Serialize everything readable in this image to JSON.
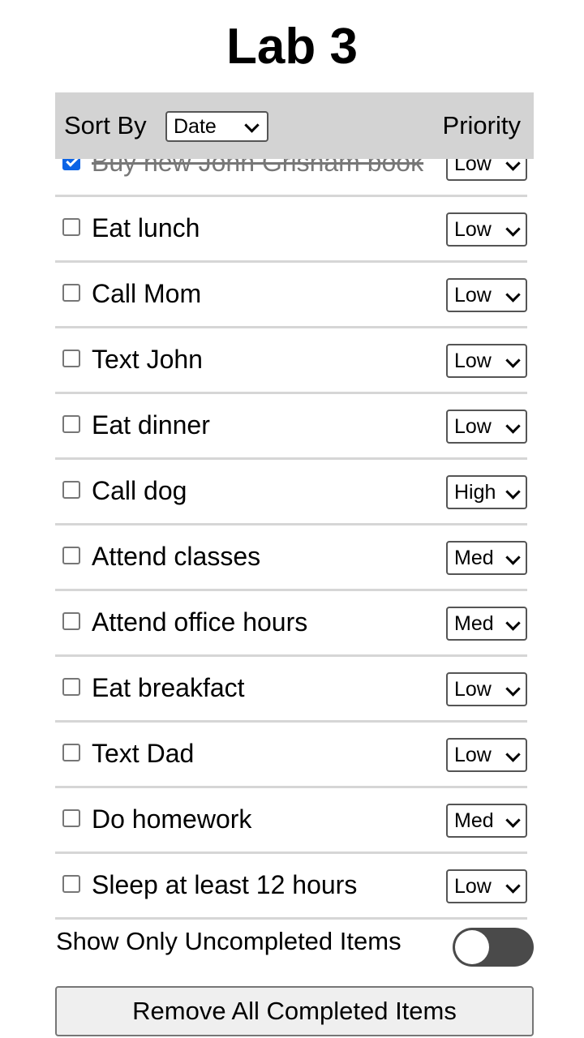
{
  "title": "Lab 3",
  "header": {
    "sort_label": "Sort By",
    "sort_value": "Date",
    "priority_heading": "Priority"
  },
  "items": [
    {
      "label": "Buy new John Grisham book",
      "done": true,
      "priority": "Low"
    },
    {
      "label": "Eat lunch",
      "done": false,
      "priority": "Low"
    },
    {
      "label": "Call Mom",
      "done": false,
      "priority": "Low"
    },
    {
      "label": "Text John",
      "done": false,
      "priority": "Low"
    },
    {
      "label": "Eat dinner",
      "done": false,
      "priority": "Low"
    },
    {
      "label": "Call dog",
      "done": false,
      "priority": "High"
    },
    {
      "label": "Attend classes",
      "done": false,
      "priority": "Med"
    },
    {
      "label": "Attend office hours",
      "done": false,
      "priority": "Med"
    },
    {
      "label": "Eat breakfact",
      "done": false,
      "priority": "Low"
    },
    {
      "label": "Text Dad",
      "done": false,
      "priority": "Low"
    },
    {
      "label": "Do homework",
      "done": false,
      "priority": "Med"
    },
    {
      "label": "Sleep at least 12 hours",
      "done": false,
      "priority": "Low"
    }
  ],
  "footer": {
    "toggle_label": "Show Only Uncompleted Items",
    "toggle_on": false,
    "remove_button": "Remove All Completed Items"
  }
}
